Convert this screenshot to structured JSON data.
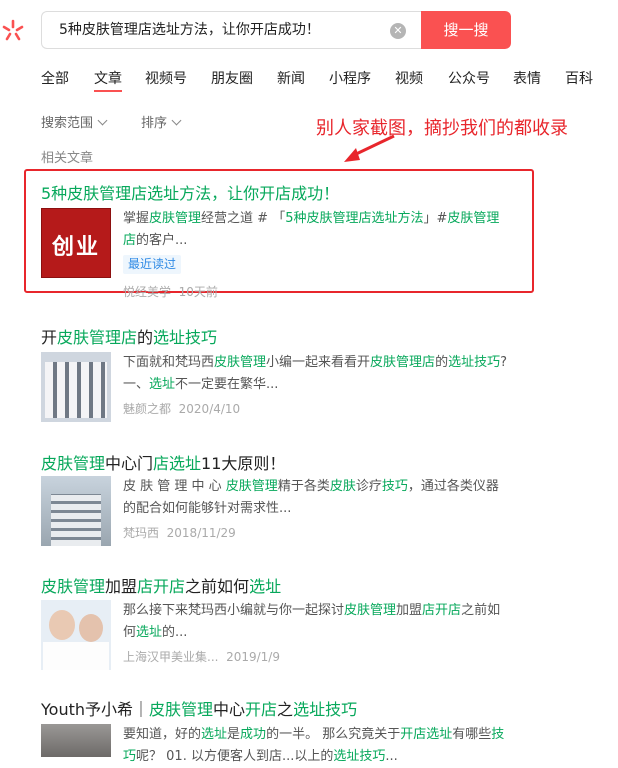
{
  "search": {
    "query": "5种皮肤管理店选址方法，让你开店成功！",
    "button_label": "搜一搜",
    "clear_icon": "close-circle-icon"
  },
  "tabs": [
    "全部",
    "文章",
    "视频号",
    "朋友圈",
    "新闻",
    "小程序",
    "视频",
    "公众号",
    "表情",
    "百科"
  ],
  "active_tab": "文章",
  "filters": {
    "scope": "搜索范围",
    "sort": "排序"
  },
  "section_label": "相关文章",
  "annotation": "别人家截图，摘抄我们的都收录",
  "results": [
    {
      "title": "5种皮肤管理店选址方法，让你开店成功！",
      "snippet": "掌握皮肤管理经营之道 # 「5种皮肤管理店选址方法」#皮肤管理店的客户...",
      "badge": "最近读过",
      "source": "悦经美学",
      "date": "10天前",
      "thumb_text": "创业",
      "highlighted": true
    },
    {
      "title": "开皮肤管理店的选址技巧",
      "snippet": "下面就和梵玛西皮肤管理小编一起来看看开皮肤管理店的选址技巧? 一、选址不一定要在繁华...",
      "source": "魅颜之都",
      "date": "2020/4/10"
    },
    {
      "title": "皮肤管理中心门店选址11大原则！",
      "snippet": "皮 肤 管 理 中 心 皮肤管理精于各类皮肤诊疗技巧，通过各类仪器的配合如何能够针对需求性...",
      "source": "梵玛西",
      "date": "2018/11/29"
    },
    {
      "title": "皮肤管理加盟店开店之前如何选址",
      "snippet": "那么接下来梵玛西小编就与你一起探讨皮肤管理加盟店开店之前如何选址的...",
      "source": "上海汉甲美业集...",
      "date": "2019/1/9"
    },
    {
      "title": "Youth予小希｜皮肤管理中心开店之选址技巧",
      "snippet": "要知道，好的选址是成功的一半。 那么究竟关于开店选址有哪些技巧呢？ 01. 以方便客人到店...以上的选址技巧..."
    }
  ]
}
